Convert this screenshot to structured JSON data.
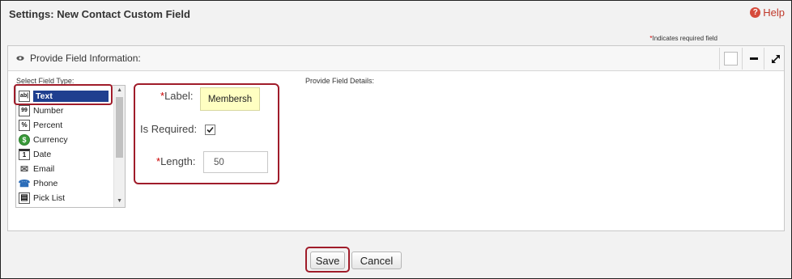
{
  "header": {
    "title": "Settings: New Contact Custom Field",
    "help_label": "Help",
    "help_icon": "question-circle-icon"
  },
  "required_note": {
    "star": "*",
    "text": "Indicates required field"
  },
  "panel": {
    "title": "Provide Field Information:",
    "icon": "eye-icon",
    "controls": [
      "checkbox-box",
      "minimize-icon",
      "expand-icon"
    ]
  },
  "field_type": {
    "label": "Select Field Type:",
    "items": [
      {
        "label": "Text",
        "icon": "text-abc-icon",
        "icon_glyph": "ab|",
        "selected": true
      },
      {
        "label": "Number",
        "icon": "number-icon",
        "icon_glyph": "99",
        "selected": false
      },
      {
        "label": "Percent",
        "icon": "percent-icon",
        "icon_glyph": "%",
        "selected": false
      },
      {
        "label": "Currency",
        "icon": "currency-dollar-icon",
        "icon_glyph": "$",
        "selected": false
      },
      {
        "label": "Date",
        "icon": "calendar-icon",
        "icon_glyph": "1",
        "selected": false
      },
      {
        "label": "Email",
        "icon": "envelope-icon",
        "icon_glyph": "✉",
        "selected": false
      },
      {
        "label": "Phone",
        "icon": "phone-icon",
        "icon_glyph": "☎",
        "selected": false
      },
      {
        "label": "Pick List",
        "icon": "pick-list-icon",
        "icon_glyph": "▤",
        "selected": false
      }
    ]
  },
  "details": {
    "label": "Provide Field Details:",
    "fields": {
      "label_field": {
        "star": "*",
        "label": "Label:",
        "value": "Membersh"
      },
      "required_field": {
        "label": "Is Required:",
        "checked": true
      },
      "length_field": {
        "star": "*",
        "label": "Length:",
        "value": "50"
      }
    }
  },
  "actions": {
    "save_label": "Save",
    "cancel_label": "Cancel"
  },
  "colors": {
    "highlight": "#a01c2a",
    "selected_bg": "#1f3f8f",
    "label_input_bg": "#ffffc2",
    "required_star": "#cc0000"
  }
}
